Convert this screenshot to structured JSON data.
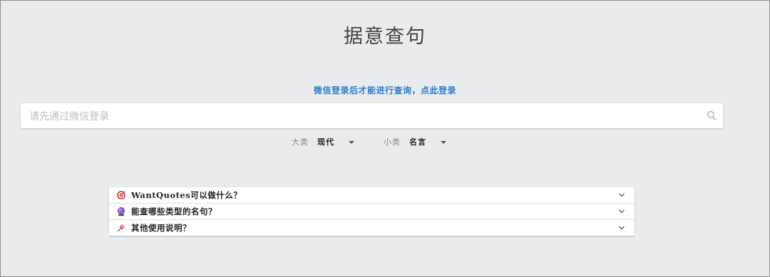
{
  "page": {
    "title": "据意查句",
    "login_prompt": "微信登录后才能进行查询，点此登录"
  },
  "search": {
    "placeholder": "请先通过微信登录",
    "icon": "search-icon"
  },
  "filters": {
    "category": {
      "label": "大类",
      "value": "现代"
    },
    "subcategory": {
      "label": "小类",
      "value": "名言"
    }
  },
  "faq": [
    {
      "icon": "target-icon",
      "text": "WantQuotes可以做什么？"
    },
    {
      "icon": "crystal-ball-icon",
      "text": "能查哪些类型的名句？"
    },
    {
      "icon": "pushpin-icon",
      "text": "其他使用说明？"
    }
  ],
  "colors": {
    "background": "#e8ecee",
    "link": "#2f7bd0"
  }
}
